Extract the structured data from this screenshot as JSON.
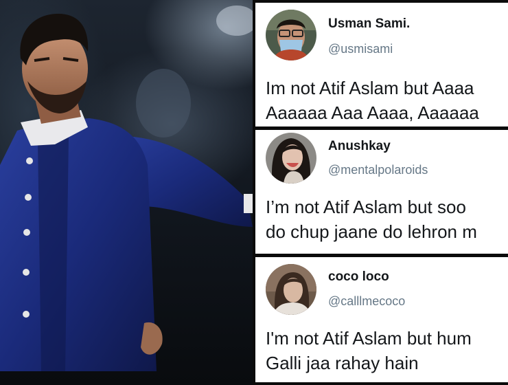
{
  "tweets": [
    {
      "name": "Usman Sami.",
      "handle": "@usmisami",
      "lines": [
        "Im not Atif Aslam but Aaaa",
        "Aaaaaa Aaa Aaaa, Aaaaaa"
      ],
      "avatar": "avatar-man-with-mask"
    },
    {
      "name": "Anushkay",
      "handle": "@mentalpolaroids",
      "lines": [
        "I’m not Atif Aslam but soo",
        "do chup jaane do lehron m"
      ],
      "avatar": "avatar-woman-with-hair"
    },
    {
      "name": "coco loco",
      "handle": "@calllmecoco",
      "lines": [
        "I'm not Atif Aslam but hum",
        "Galli jaa rahay hain"
      ],
      "avatar": "avatar-woman-in-dim-light"
    }
  ],
  "colors": {
    "name_text": "#14171a",
    "handle_text": "#657786",
    "card_background": "#ffffff",
    "suit": "#1a2a7a"
  }
}
